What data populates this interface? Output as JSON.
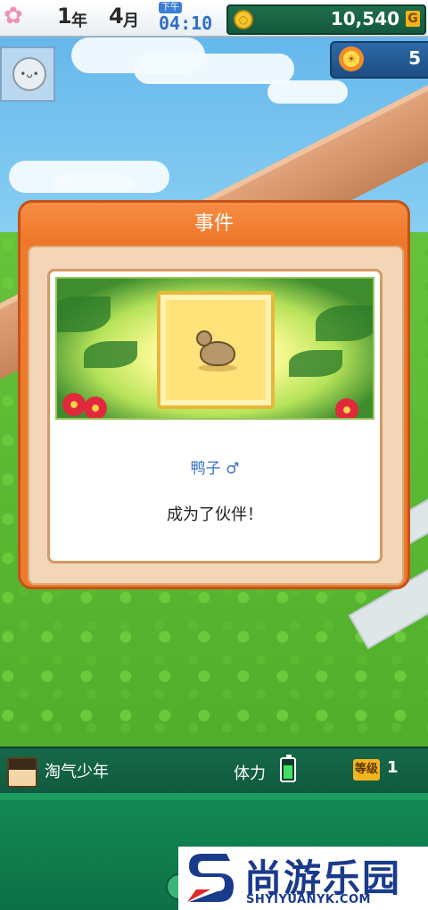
{
  "hud": {
    "year": "1",
    "year_unit": "年",
    "month": "4",
    "month_unit": "月",
    "ampm": "下午",
    "time": "04:10",
    "money": "10,540",
    "currency_symbol": "G",
    "sun_count": "5"
  },
  "dialog": {
    "title": "事件",
    "animal_name": "鸭子 ♂",
    "message": "成为了伙伴！"
  },
  "status": {
    "player_name": "淘气少年",
    "stamina_label": "体力",
    "stamina_level": 0.75,
    "level_label": "等级",
    "level_value": "1"
  },
  "watermark": {
    "brand": "尚游乐园",
    "url": "SHYIYUANYK.COM"
  },
  "colors": {
    "dialog_orange": "#f07a2b",
    "panel_green": "#0f5a3e",
    "money_green": "#1f6d4c",
    "name_blue": "#3a6fc8"
  },
  "icons": [
    "blossom-icon",
    "coin-icon",
    "gold-g-icon",
    "sun-icon",
    "duck-icon",
    "player-icon",
    "battery-icon"
  ]
}
